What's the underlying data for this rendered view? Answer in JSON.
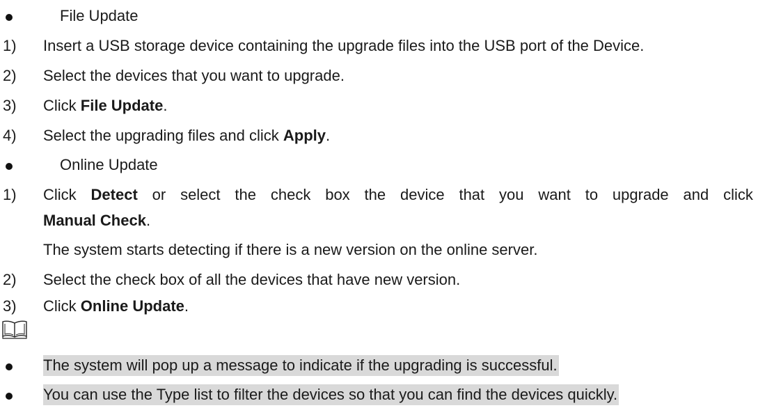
{
  "sections": {
    "file_update": {
      "heading": "File Update",
      "steps": [
        {
          "num": "1)",
          "pre": "Insert a USB storage device containing the upgrade files into the USB port of the Device.",
          "bold": "",
          "post": ""
        },
        {
          "num": "2)",
          "pre": "Select the devices that you want to upgrade.",
          "bold": "",
          "post": ""
        },
        {
          "num": "3)",
          "pre": "Click ",
          "bold": "File Update",
          "post": "."
        },
        {
          "num": "4)",
          "pre": "Select the upgrading files and click ",
          "bold": "Apply",
          "post": "."
        }
      ]
    },
    "online_update": {
      "heading": "Online Update",
      "step1": {
        "num": "1)",
        "words": [
          "Click",
          "Detect",
          "or",
          "select",
          "the",
          "check",
          "box",
          "the",
          "device",
          "that",
          "you",
          "want",
          "to",
          "upgrade",
          "and",
          "click"
        ],
        "line2_bold": "Manual Check",
        "line2_post": ".",
        "sub": "The system starts detecting if there is a new version on the online server."
      },
      "steps": [
        {
          "num": "2)",
          "pre": "Select the check box of all the devices that have new version.",
          "bold": "",
          "post": ""
        },
        {
          "num": "3)",
          "pre": "Click ",
          "bold": "Online Update",
          "post": "."
        }
      ]
    }
  },
  "note": {
    "icon": "book-icon",
    "items": [
      "The system will pop up a message to indicate if the upgrading is successful.",
      "You can use the Type list to filter the devices so that you can find the devices quickly."
    ]
  }
}
